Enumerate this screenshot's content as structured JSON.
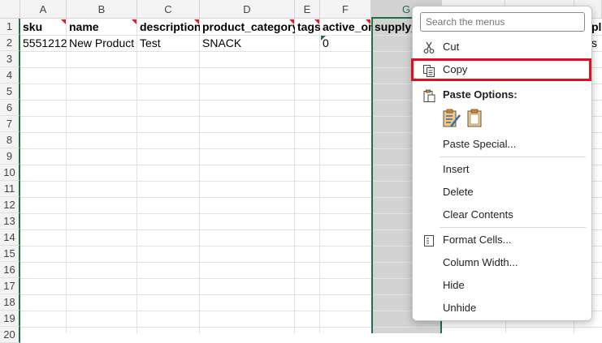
{
  "columns": [
    "A",
    "B",
    "C",
    "D",
    "E",
    "F",
    "G",
    "",
    "",
    "",
    "",
    "",
    "",
    "",
    "",
    ""
  ],
  "rows": [
    "1",
    "2",
    "3",
    "4",
    "5",
    "6",
    "7",
    "8",
    "9",
    "10",
    "11",
    "12",
    "13",
    "14",
    "15",
    "16",
    "17",
    "18",
    "19",
    "20"
  ],
  "cells": {
    "A1": "sku",
    "B1": "name",
    "C1": "description",
    "D1": "product_category",
    "E1": "tags",
    "F1": "active_on",
    "G1": "supply_",
    "A2": "5551212",
    "B2": "New Product",
    "C2": "Test",
    "D2": "SNACK",
    "F2": "0",
    "J1_partial": "pl",
    "J2_partial": "s"
  },
  "context_menu": {
    "search_placeholder": "Search the menus",
    "items": {
      "cut": "Cut",
      "copy": "Copy",
      "paste_options": "Paste Options:",
      "paste_special": "Paste Special...",
      "insert": "Insert",
      "delete": "Delete",
      "clear_contents": "Clear Contents",
      "format_cells": "Format Cells...",
      "column_width": "Column Width...",
      "hide": "Hide",
      "unhide": "Unhide"
    }
  },
  "colors": {
    "accent": "#1e7145",
    "highlight": "#e0101e",
    "comment": "#e01b24"
  }
}
